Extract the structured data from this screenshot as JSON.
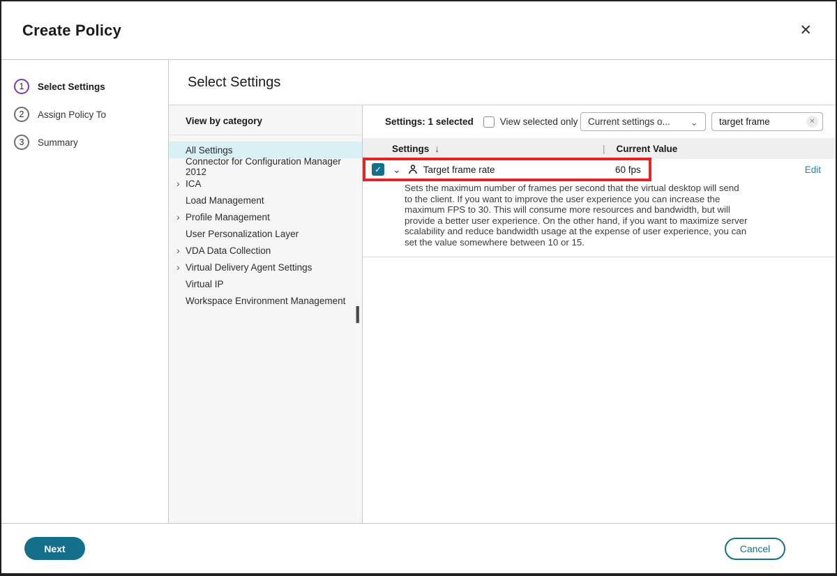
{
  "window": {
    "title": "Create Policy"
  },
  "icons": {
    "close": "✕",
    "check": "✓",
    "sort_down": "↓",
    "chevron_down": "⌄",
    "chevron_right": "›",
    "clear": "✕",
    "drag_dots": "▪\n▪\n▪\n▪\n▪\n▪",
    "column_separator": "|"
  },
  "stepper": {
    "steps": [
      {
        "number": "1",
        "label": "Select Settings"
      },
      {
        "number": "2",
        "label": "Assign Policy To"
      },
      {
        "number": "3",
        "label": "Summary"
      }
    ]
  },
  "content": {
    "heading": "Select Settings",
    "categories": {
      "header": "View by category",
      "items": [
        {
          "label": "All Settings"
        },
        {
          "label": "Connector for Configuration Manager 2012"
        },
        {
          "label": "ICA"
        },
        {
          "label": "Load Management"
        },
        {
          "label": "Profile Management"
        },
        {
          "label": "User Personalization Layer"
        },
        {
          "label": "VDA Data Collection"
        },
        {
          "label": "Virtual Delivery Agent Settings"
        },
        {
          "label": "Virtual IP"
        },
        {
          "label": "Workspace Environment Management"
        }
      ]
    },
    "settings": {
      "selected_count": "Settings: 1 selected",
      "view_selected_only": "View selected only",
      "filter_dropdown_value": "Current settings o...",
      "search_value": "target frame",
      "columns": {
        "settings": "Settings",
        "current_value": "Current Value"
      },
      "row": {
        "name": "Target frame rate",
        "value": "60 fps",
        "edit": "Edit",
        "description": "Sets the maximum number of frames per second that the virtual desktop will send to the client. If you want to improve the user experience you can increase the maximum FPS to 30. This will consume more resources and bandwidth, but will provide a better user experience. On the other hand, if you want to maximize server scalability and reduce bandwidth usage at the expense of user experience, you can set the value somewhere between 10 or 15."
      }
    }
  },
  "footer": {
    "next": "Next",
    "cancel": "Cancel"
  },
  "colors": {
    "accent_teal": "#14708a",
    "link_blue": "#1e82aa",
    "step_active_purple": "#7b35cc",
    "selected_category_bg": "#d9f0f4",
    "highlight_red": "#e42525"
  }
}
